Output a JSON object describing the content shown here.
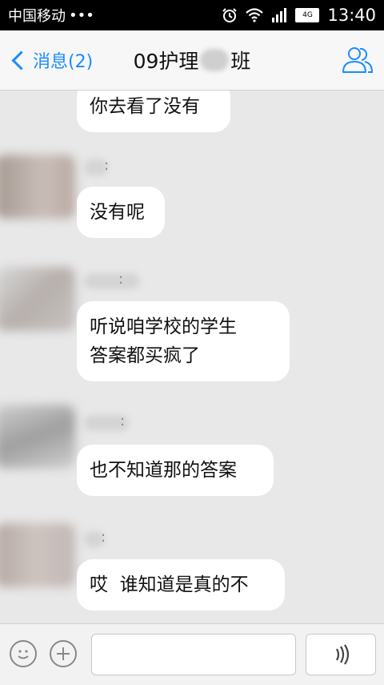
{
  "status_bar": {
    "carrier": "中国移动",
    "dots": "•••",
    "network": "4G",
    "time": "13:40",
    "icons": [
      "alarm-icon",
      "wifi-icon",
      "signal-icon",
      "battery-icon"
    ]
  },
  "nav": {
    "back_label": "消息(2)",
    "title_prefix": "09护理",
    "title_suffix": "班",
    "group_icon": "group-members-icon",
    "accent_color": "#1a8cff"
  },
  "messages": [
    {
      "text": "你去看了没有"
    },
    {
      "text": "没有呢"
    },
    {
      "text": "听说咱学校的学生\n答案都买疯了"
    },
    {
      "text": "也不知道那的答案"
    },
    {
      "text": "哎  谁知道是真的不"
    }
  ],
  "input_bar": {
    "emoji_icon": "emoji-icon",
    "plus_icon": "plus-icon",
    "voice_icon": "voice-icon",
    "text_value": ""
  }
}
